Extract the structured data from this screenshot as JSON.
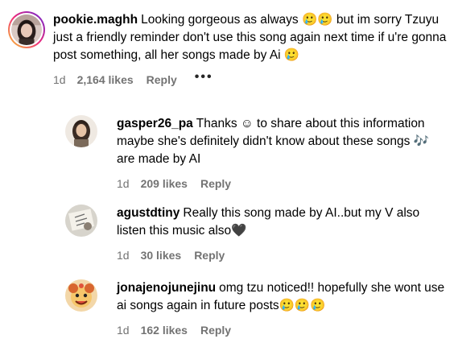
{
  "comments": [
    {
      "username": "pookie.maghh",
      "text": "Looking gorgeous as always 🥲🥲 but im sorry Tzuyu just a friendly reminder don't use this song again next time if u're gonna post something, all her songs made by Ai 🥲",
      "time": "1d",
      "likes": "2,164 likes",
      "reply_label": "Reply",
      "more_label": "•••",
      "avatar_icon": "profile-photo-girl"
    }
  ],
  "replies": [
    {
      "username": "gasper26_pa",
      "text": "Thanks ☺ to share about this information maybe she's definitely didn't know about these songs 🎶 are made by AI",
      "time": "1d",
      "likes": "209 likes",
      "reply_label": "Reply",
      "avatar_icon": "profile-photo-drawing"
    },
    {
      "username": "agustdtiny",
      "text": "Really this song made by AI..but my V also listen this music also🖤",
      "time": "1d",
      "likes": "30 likes",
      "reply_label": "Reply",
      "avatar_icon": "profile-photo-sketch"
    },
    {
      "username": "jonajenojunejinu",
      "text": "omg tzu noticed!! hopefully she wont use ai songs again in future posts🥲🥲🥲",
      "time": "1d",
      "likes": "162 likes",
      "reply_label": "Reply",
      "avatar_icon": "profile-photo-cartoon"
    }
  ],
  "colors": {
    "text": "#000000",
    "meta": "#737373",
    "story_ring_start": "#f9ce34",
    "story_ring_mid": "#ee2a7b",
    "story_ring_end": "#6228d7"
  }
}
